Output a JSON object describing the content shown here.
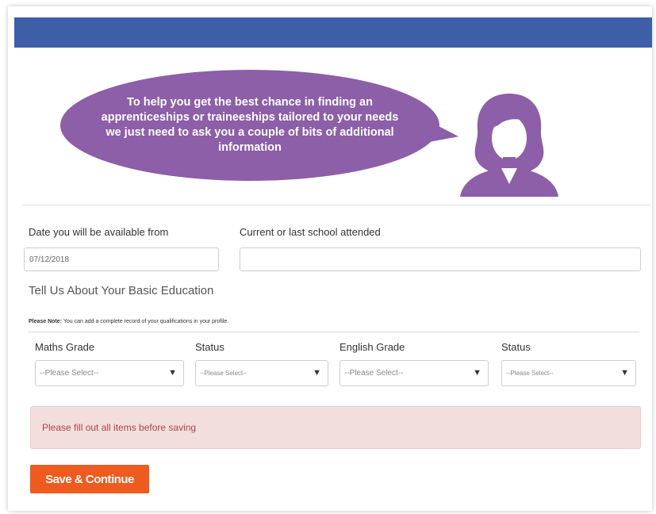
{
  "colors": {
    "header_bar": "#3f5ea8",
    "bubble": "#8c5fa8",
    "avatar": "#8c5fa8",
    "alert_bg": "#f3dede",
    "alert_text": "#a94442",
    "button": "#ef5a1e"
  },
  "speech_bubble": {
    "text": "To help you get the best chance in finding an apprenticeships or traineeships tailored to your needs we just need to ask you a couple of bits of additional information",
    "avatar_icon": "woman-avatar-icon"
  },
  "form": {
    "date_label": "Date you will be available from",
    "date_value": "07/12/2018",
    "school_label": "Current or last school attended",
    "school_value": ""
  },
  "education": {
    "title": "Tell Us About Your Basic Education",
    "note_bold": "Please Note:",
    "note_text": " You can add a complete record of your qualifications in your profile.",
    "fields": [
      {
        "label": "Maths Grade",
        "value": "--Please Select--"
      },
      {
        "label": "Status",
        "value": "--Please Select--"
      },
      {
        "label": "English Grade",
        "value": "--Please Select--"
      },
      {
        "label": "Status",
        "value": "--Please Select--"
      }
    ],
    "dropdown_icon": "caret-down-icon"
  },
  "alert": {
    "text": "Please fill out all items before saving"
  },
  "actions": {
    "save_label": "Save & Continue"
  }
}
